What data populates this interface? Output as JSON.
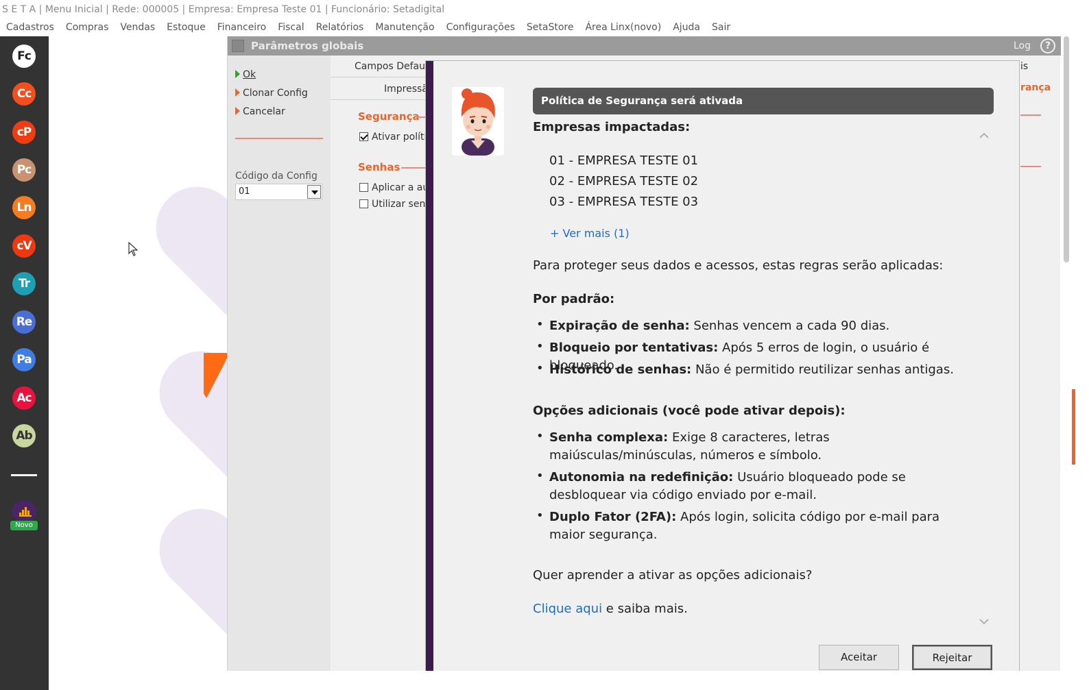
{
  "titlebar": {
    "text": "S E T A | Menu Inicial | Rede: 000005 | Empresa: Empresa Teste  01 | Funcionário: Setadigital"
  },
  "menu": [
    "Cadastros",
    "Compras",
    "Vendas",
    "Estoque",
    "Financeiro",
    "Fiscal",
    "Relatórios",
    "Manutenção",
    "Configurações",
    "SetaStore",
    "Área Linx(novo)",
    "Ajuda",
    "Sair"
  ],
  "sidebar": {
    "apps": [
      {
        "label": "Fc",
        "color": "#ffffff",
        "text_color": "#222222"
      },
      {
        "label": "Cc",
        "color": "#f24e1e",
        "text_color": "#ffffff"
      },
      {
        "label": "cP",
        "color": "#ee3d12",
        "text_color": "#ffffff"
      },
      {
        "label": "Pc",
        "color": "#c99272",
        "text_color": "#ffffff"
      },
      {
        "label": "Ln",
        "color": "#f57c20",
        "text_color": "#ffffff"
      },
      {
        "label": "cV",
        "color": "#ee3810",
        "text_color": "#ffffff"
      },
      {
        "label": "Tr",
        "color": "#1f9fb3",
        "text_color": "#ffffff"
      },
      {
        "label": "Re",
        "color": "#4a6fd4",
        "text_color": "#ffffff"
      },
      {
        "label": "Pa",
        "color": "#3f7ee0",
        "text_color": "#ffffff"
      },
      {
        "label": "Ac",
        "color": "#e8123f",
        "text_color": "#ffffff"
      },
      {
        "label": "Ab",
        "color": "#c8d7a0",
        "text_color": "#333333"
      }
    ],
    "novo_label": "Novo"
  },
  "param_window": {
    "title": "Parâmetros globais",
    "log": "Log",
    "help": "?",
    "actions": {
      "ok": "Ok",
      "clone": "Clonar Config",
      "cancel": "Cancelar"
    },
    "config_label": "Código da Config",
    "config_value": "01",
    "tabs": {
      "campos": "Campos Default",
      "impressao": "Impressão"
    },
    "sections": {
      "seguranca": "Segurança",
      "senhas": "Senhas"
    },
    "checkboxes": {
      "ativar": {
        "label": "Ativar polític",
        "checked": true
      },
      "aplicar": {
        "label": "Aplicar a aut",
        "checked": false
      },
      "utilizar": {
        "label": "Utilizar senh",
        "checked": false
      }
    },
    "right_tab_fragment": "is",
    "right_section_fragment": "rança"
  },
  "modal": {
    "banner": "Política de Segurança será ativada",
    "companies_heading": "Empresas impactadas:",
    "companies": [
      "01 - EMPRESA TESTE 01",
      "02 - EMPRESA TESTE 02",
      "03 - EMPRESA TESTE 03"
    ],
    "see_more": "+ Ver mais (1)",
    "intro": "Para proteger seus dados e acessos, estas regras serão aplicadas:",
    "default_heading": "Por padrão:",
    "default_rules": [
      {
        "title": "Expiração de senha:",
        "text": " Senhas vencem a cada 90 dias."
      },
      {
        "title": "Bloqueio por tentativas:",
        "text": " Após 5 erros de login, o usuário é bloqueado."
      },
      {
        "title": "Histórico de senhas:",
        "text": " Não é permitido reutilizar senhas antigas."
      }
    ],
    "additional_heading": "Opções adicionais (você pode ativar depois):",
    "additional_rules": [
      {
        "title": "Senha complexa:",
        "text": " Exige 8 caracteres, letras maiúsculas/minúsculas, números e símbolo."
      },
      {
        "title": "Autonomia na redefinição:",
        "text": " Usuário bloqueado pode se desbloquear via código enviado por e-mail."
      },
      {
        "title": "Duplo Fator (2FA):",
        "text": " Após login, solicita código por e-mail para maior segurança."
      }
    ],
    "question": "Quer aprender a ativar as opções adicionais?",
    "learn_link": "Clique aqui",
    "learn_suffix": " e saiba mais.",
    "accept_button": "Aceitar",
    "reject_button": "Rejeitar"
  }
}
